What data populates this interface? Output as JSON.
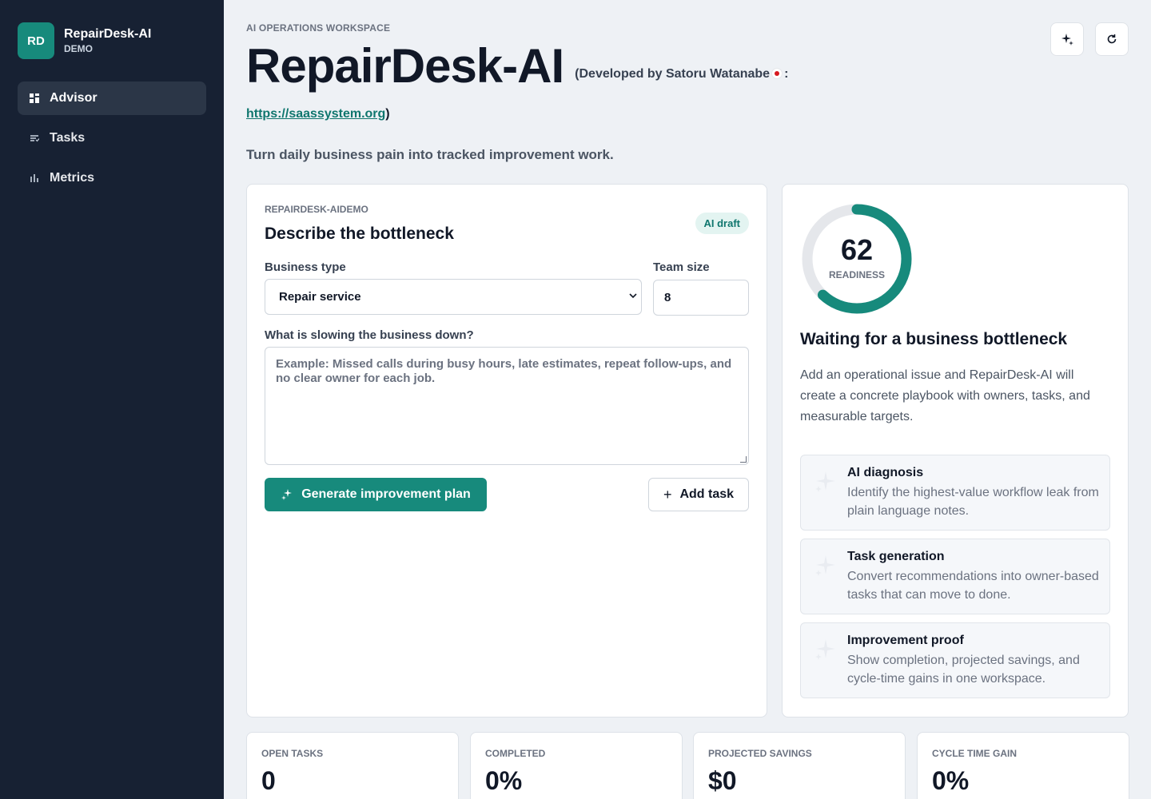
{
  "brand": {
    "initials": "RD",
    "name": "RepairDesk-AI",
    "sub": "DEMO"
  },
  "nav": [
    {
      "label": "Advisor",
      "icon": "grid-icon",
      "active": true
    },
    {
      "label": "Tasks",
      "icon": "task-list-icon",
      "active": false
    },
    {
      "label": "Metrics",
      "icon": "bar-chart-icon",
      "active": false
    }
  ],
  "header": {
    "eyebrow": "AI OPERATIONS WORKSPACE",
    "title": "RepairDesk-AI",
    "dev_note_pre": "(Developed by Satoru Watanabe",
    "dev_note_post": ":",
    "link": "https://saassystem.org",
    "link_suffix": ")",
    "tagline": "Turn daily business pain into tracked improvement work."
  },
  "actions": {
    "sparkle_icon": "sparkle-icon",
    "refresh_icon": "refresh-icon"
  },
  "form": {
    "eyebrow": "REPAIRDESK-AIDEMO",
    "title": "Describe the bottleneck",
    "badge": "AI draft",
    "business_type_label": "Business type",
    "business_type_value": "Repair service",
    "team_size_label": "Team size",
    "team_size_value": "8",
    "slow_label": "What is slowing the business down?",
    "slow_placeholder": "Example: Missed calls during busy hours, late estimates, repeat follow-ups, and no clear owner for each job.",
    "generate_label": "Generate improvement plan",
    "add_task_label": "Add task"
  },
  "readiness": {
    "value": 62,
    "label": "READINESS",
    "title": "Waiting for a business bottleneck",
    "description": "Add an operational issue and RepairDesk-AI will create a concrete playbook with owners, tasks, and measurable targets.",
    "accent": "#178a7c",
    "track": "#e5e7eb"
  },
  "features": [
    {
      "title": "AI diagnosis",
      "desc": "Identify the highest-value workflow leak from plain language notes."
    },
    {
      "title": "Task generation",
      "desc": "Convert recommendations into owner-based tasks that can move to done."
    },
    {
      "title": "Improvement proof",
      "desc": "Show completion, projected savings, and cycle-time gains in one workspace."
    }
  ],
  "stats": [
    {
      "label": "OPEN TASKS",
      "value": "0"
    },
    {
      "label": "COMPLETED",
      "value": "0%"
    },
    {
      "label": "PROJECTED SAVINGS",
      "value": "$0"
    },
    {
      "label": "CYCLE TIME GAIN",
      "value": "0%"
    }
  ]
}
